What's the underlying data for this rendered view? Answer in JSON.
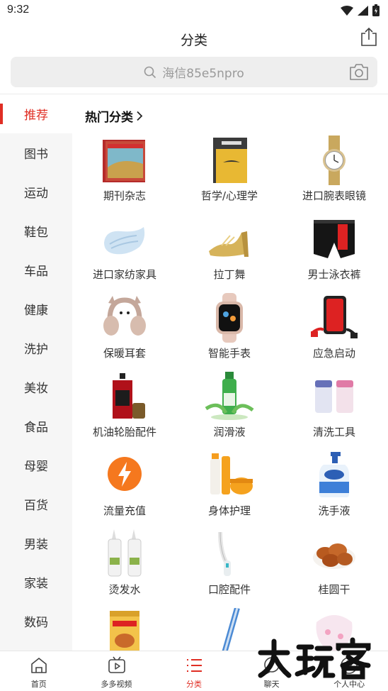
{
  "status_bar": {
    "time": "9:32"
  },
  "header": {
    "title": "分类"
  },
  "search": {
    "placeholder": "海信85e5npro"
  },
  "sidebar": {
    "items": [
      {
        "label": "推荐",
        "active": true
      },
      {
        "label": "图书"
      },
      {
        "label": "运动"
      },
      {
        "label": "鞋包"
      },
      {
        "label": "车品"
      },
      {
        "label": "健康"
      },
      {
        "label": "洗护"
      },
      {
        "label": "美妆"
      },
      {
        "label": "食品"
      },
      {
        "label": "母婴"
      },
      {
        "label": "百货"
      },
      {
        "label": "男装"
      },
      {
        "label": "家装"
      },
      {
        "label": "数码"
      }
    ]
  },
  "main": {
    "section_title": "热门分类",
    "categories": [
      {
        "label": "期刊杂志",
        "icon": "magazine-icon"
      },
      {
        "label": "哲学/心理学",
        "icon": "book-icon"
      },
      {
        "label": "进口腕表眼镜",
        "icon": "watch-icon"
      },
      {
        "label": "进口家纺家具",
        "icon": "pillow-icon"
      },
      {
        "label": "拉丁舞",
        "icon": "dance-shoe-icon"
      },
      {
        "label": "男士泳衣裤",
        "icon": "swim-trunks-icon"
      },
      {
        "label": "保暖耳套",
        "icon": "earmuff-icon"
      },
      {
        "label": "智能手表",
        "icon": "smartwatch-icon"
      },
      {
        "label": "应急启动",
        "icon": "jump-starter-icon"
      },
      {
        "label": "机油轮胎配件",
        "icon": "motor-oil-icon"
      },
      {
        "label": "润滑液",
        "icon": "lubricant-icon"
      },
      {
        "label": "清洗工具",
        "icon": "cleaning-case-icon"
      },
      {
        "label": "流量充值",
        "icon": "lightning-icon"
      },
      {
        "label": "身体护理",
        "icon": "body-care-icon"
      },
      {
        "label": "洗手液",
        "icon": "hand-soap-icon"
      },
      {
        "label": "烫发水",
        "icon": "perm-lotion-icon"
      },
      {
        "label": "口腔配件",
        "icon": "water-flosser-icon"
      },
      {
        "label": "桂圆干",
        "icon": "dried-longan-icon"
      },
      {
        "label": "",
        "icon": "milk-powder-icon"
      },
      {
        "label": "",
        "icon": "toothbrush-icon"
      },
      {
        "label": "",
        "icon": "baby-bib-icon"
      }
    ]
  },
  "tabbar": {
    "tabs": [
      {
        "label": "首页",
        "icon": "home-icon"
      },
      {
        "label": "多多视频",
        "icon": "video-icon"
      },
      {
        "label": "分类",
        "icon": "category-list-icon",
        "active": true
      },
      {
        "label": "聊天",
        "icon": "chat-icon"
      },
      {
        "label": "个人中心",
        "icon": "profile-icon"
      }
    ]
  },
  "watermark": {
    "text": "大玩客"
  },
  "colors": {
    "accent": "#e02e24",
    "sidebar_bg": "#f6f6f6",
    "search_bg": "#eeeeee"
  }
}
